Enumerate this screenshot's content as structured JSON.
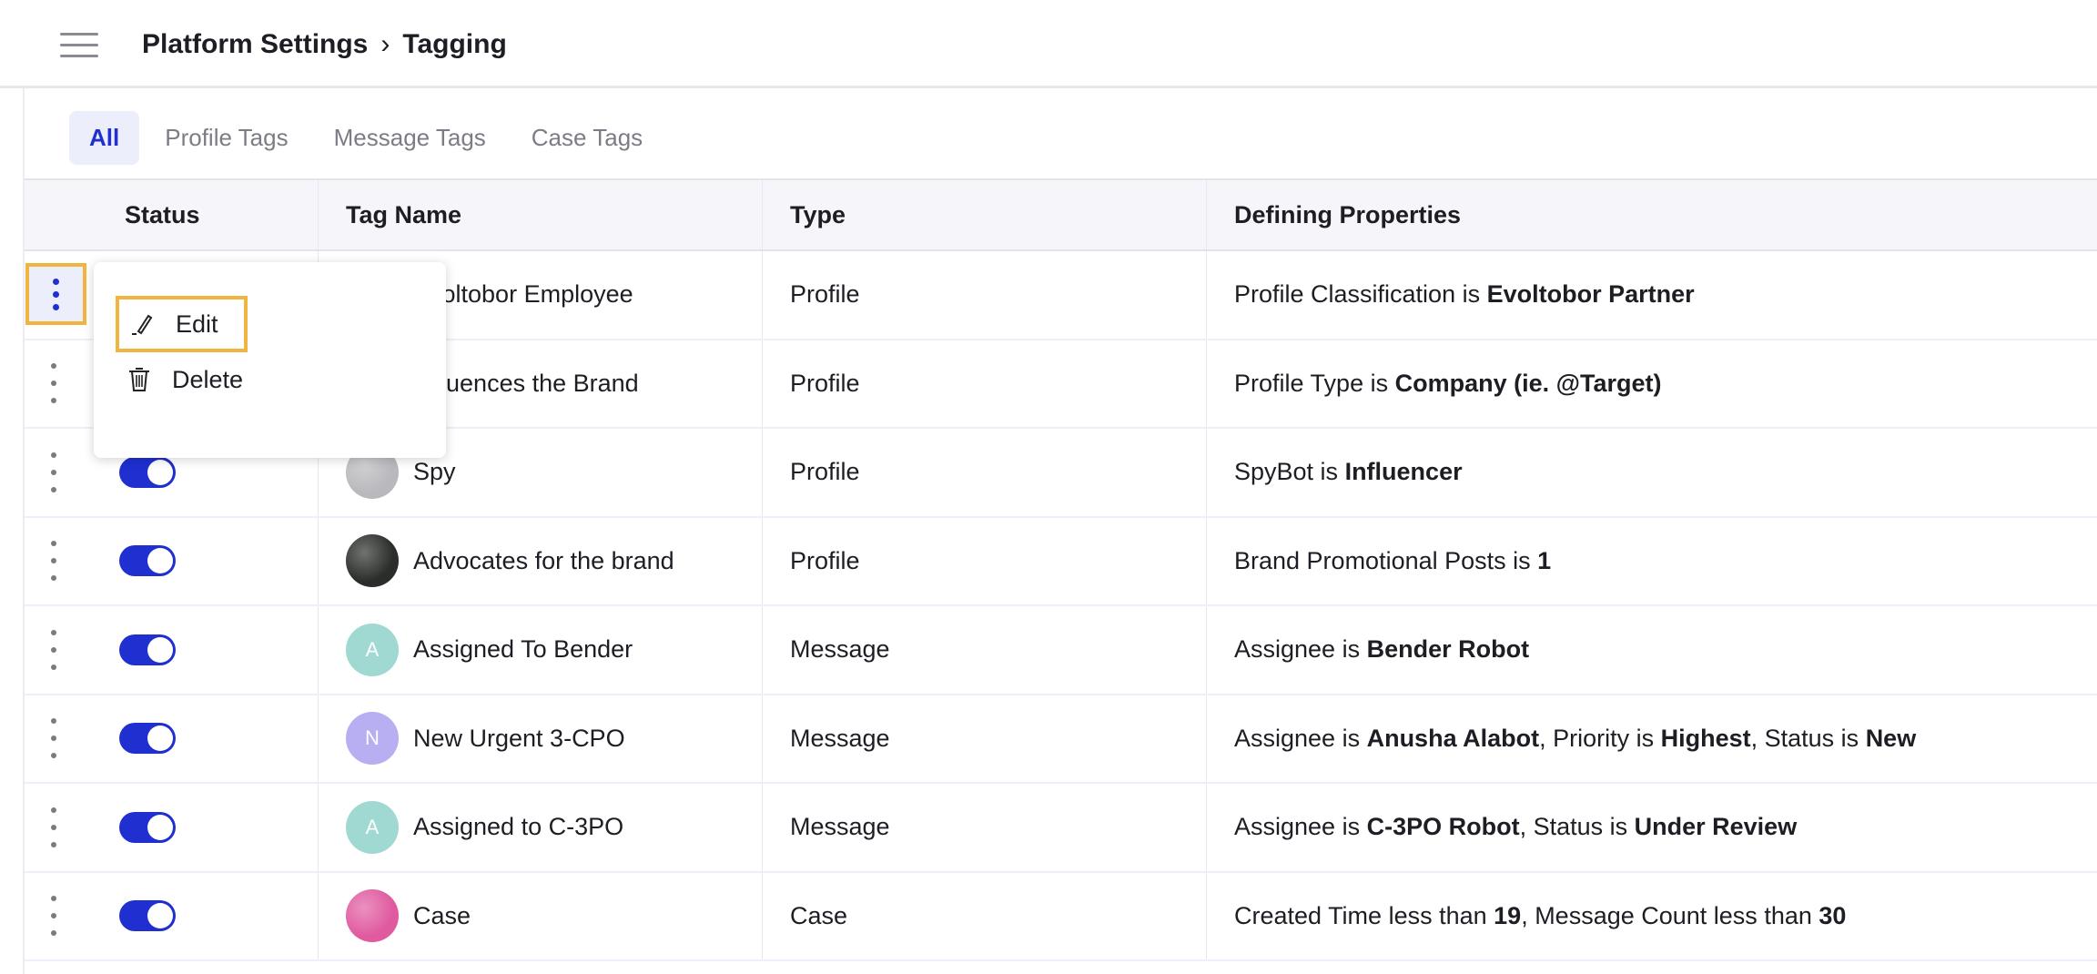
{
  "header": {
    "breadcrumb": [
      "Platform Settings",
      "Tagging"
    ],
    "separator": "›"
  },
  "tabs": [
    {
      "label": "All",
      "active": true
    },
    {
      "label": "Profile Tags"
    },
    {
      "label": "Message Tags"
    },
    {
      "label": "Case Tags"
    }
  ],
  "columns": [
    "Status",
    "Tag Name",
    "Type",
    "Defining Properties"
  ],
  "rows": [
    {
      "name": "Evoltobor Employee",
      "type": "Profile",
      "enabled": true,
      "avatar": {
        "kind": "image",
        "color": "#6b7fa0"
      },
      "props": [
        {
          "t": "Profile Classification is "
        },
        {
          "t": "Evoltobor Partner",
          "b": true
        }
      ]
    },
    {
      "name": "Influences the Brand",
      "type": "Profile",
      "enabled": true,
      "avatar": {
        "kind": "image",
        "color": "#a08a6b"
      },
      "props": [
        {
          "t": "Profile Type is "
        },
        {
          "t": "Company (ie. @Target)",
          "b": true
        }
      ]
    },
    {
      "name": "Spy",
      "type": "Profile",
      "enabled": true,
      "avatar": {
        "kind": "image",
        "color": "#b9b9bd"
      },
      "props": [
        {
          "t": "SpyBot is "
        },
        {
          "t": "Influencer",
          "b": true
        }
      ]
    },
    {
      "name": "Advocates for the brand",
      "type": "Profile",
      "enabled": true,
      "avatar": {
        "kind": "image",
        "color": "#2b2d2a"
      },
      "props": [
        {
          "t": "Brand Promotional Posts is "
        },
        {
          "t": "1",
          "b": true
        }
      ]
    },
    {
      "name": "Assigned To Bender",
      "type": "Message",
      "enabled": true,
      "avatar": {
        "kind": "letter",
        "letter": "A",
        "color": "#9fd9d2"
      },
      "props": [
        {
          "t": "Assignee is "
        },
        {
          "t": "Bender Robot",
          "b": true
        }
      ]
    },
    {
      "name": "New Urgent 3-CPO",
      "type": "Message",
      "enabled": true,
      "avatar": {
        "kind": "letter",
        "letter": "N",
        "color": "#b8aef2"
      },
      "props": [
        {
          "t": "Assignee is "
        },
        {
          "t": "Anusha Alabot",
          "b": true
        },
        {
          "t": ", Priority is "
        },
        {
          "t": "Highest",
          "b": true
        },
        {
          "t": ", Status is "
        },
        {
          "t": "New",
          "b": true
        }
      ]
    },
    {
      "name": "Assigned to C-3PO",
      "type": "Message",
      "enabled": true,
      "avatar": {
        "kind": "letter",
        "letter": "A",
        "color": "#9fd9d2"
      },
      "props": [
        {
          "t": "Assignee is "
        },
        {
          "t": "C-3PO Robot",
          "b": true
        },
        {
          "t": ", Status is "
        },
        {
          "t": "Under Review",
          "b": true
        }
      ]
    },
    {
      "name": "Case",
      "type": "Case",
      "enabled": true,
      "avatar": {
        "kind": "image",
        "color": "#e05aa0"
      },
      "props": [
        {
          "t": "Created Time less than "
        },
        {
          "t": "19",
          "b": true
        },
        {
          "t": ", Message Count less than "
        },
        {
          "t": "30",
          "b": true
        }
      ]
    }
  ],
  "context_menu": {
    "items": [
      {
        "label": "Edit",
        "icon": "pencil-icon"
      },
      {
        "label": "Delete",
        "icon": "trash-icon"
      }
    ]
  },
  "colors": {
    "accent": "#1f2fd0",
    "highlight": "#f0b540"
  }
}
